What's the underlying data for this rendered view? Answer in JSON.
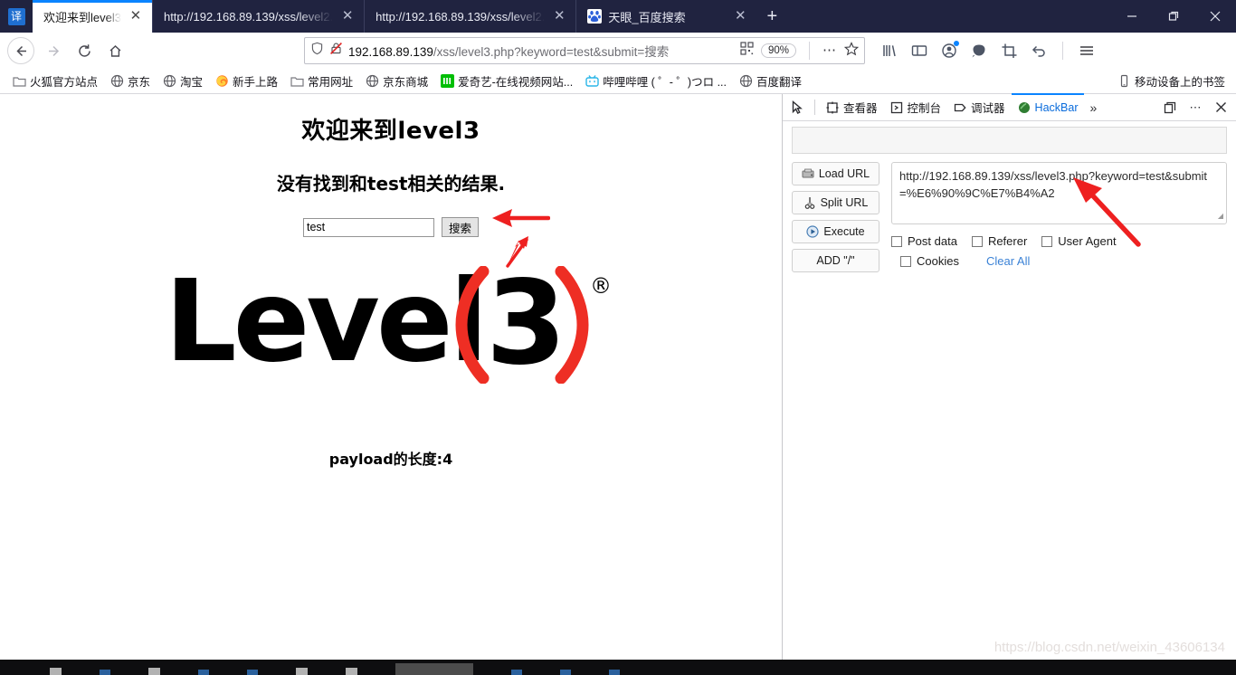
{
  "browser": {
    "tabs": [
      {
        "title": "欢迎来到level3",
        "favicon": "none",
        "active": true
      },
      {
        "title": "http://192.168.89.139/xss/level2.",
        "favicon": "none",
        "active": false
      },
      {
        "title": "http://192.168.89.139/xss/level2.",
        "favicon": "none",
        "active": false
      },
      {
        "title": "天眼_百度搜索",
        "favicon": "baidu-icon",
        "active": false
      }
    ],
    "translate_badge": "译",
    "new_tab_label": "+",
    "window_controls": {
      "minimize": "–",
      "maximize": "❐",
      "close": "✕"
    },
    "nav": {
      "back_icon": "back-arrow-icon",
      "forward_icon": "forward-arrow-icon",
      "reload_icon": "reload-icon",
      "home_icon": "home-icon",
      "url_host": "192.168.89.139",
      "url_path": "/xss/level3.php?keyword=test&submit=搜索",
      "shield_icon": "shield-icon",
      "insecure_icon": "insecure-lock-icon",
      "qr_icon": "qr-code-icon",
      "zoom_level": "90%",
      "more_icon": "ellipsis-icon",
      "bookmark_icon": "star-icon",
      "library_icon": "library-icon",
      "sidebar_icon": "sidebar-icon",
      "account_icon": "account-icon",
      "pocket_icon": "pocket-icon",
      "screenshot_icon": "screenshot-icon",
      "undo_icon": "undo-icon",
      "menu_icon": "hamburger-menu-icon"
    },
    "bookmarks": [
      {
        "label": "火狐官方站点",
        "icon": "folder-icon"
      },
      {
        "label": "京东",
        "icon": "globe-icon"
      },
      {
        "label": "淘宝",
        "icon": "globe-icon"
      },
      {
        "label": "新手上路",
        "icon": "firefox-icon"
      },
      {
        "label": "常用网址",
        "icon": "folder-icon"
      },
      {
        "label": "京东商城",
        "icon": "globe-icon"
      },
      {
        "label": "爱奇艺-在线视频网站...",
        "icon": "iqiyi-icon"
      },
      {
        "label": "哔哩哔哩 ( ゜- ゜)つロ ...",
        "icon": "bilibili-icon"
      },
      {
        "label": "百度翻译",
        "icon": "globe-icon"
      }
    ],
    "bookmarks_right": {
      "label": "移动设备上的书签",
      "icon": "mobile-icon"
    }
  },
  "page": {
    "welcome_heading": "欢迎来到level3",
    "result_text": "没有找到和test相关的结果.",
    "search_value": "test",
    "search_placeholder": "",
    "search_button": "搜索",
    "logo": {
      "text": "Level",
      "paren_open": "(",
      "digit": "3",
      "paren_close": ")",
      "registered": "®",
      "accent_color": "#ee2e24"
    },
    "payload_text": "payload的长度:4",
    "watermark": "https://blog.csdn.net/weixin_43606134"
  },
  "devtools": {
    "picker_icon": "element-picker-icon",
    "tabs": [
      {
        "label": "查看器",
        "icon": "inspector-icon",
        "active": false
      },
      {
        "label": "控制台",
        "icon": "console-icon",
        "active": false
      },
      {
        "label": "调试器",
        "icon": "debugger-icon",
        "active": false
      },
      {
        "label": "HackBar",
        "icon": "hackbar-icon",
        "active": true
      }
    ],
    "overflow_label": "»",
    "dock_icon": "dock-icon",
    "more_icon": "ellipsis-icon",
    "close_icon": "close-icon",
    "hackbar": {
      "buttons": [
        {
          "label": "Load URL",
          "icon": "load-url-icon"
        },
        {
          "label": "Split URL",
          "icon": "split-url-icon"
        },
        {
          "label": "Execute",
          "icon": "execute-icon"
        },
        {
          "label": "ADD \"/\"",
          "icon": "none"
        }
      ],
      "url_value": "http://192.168.89.139/xss/level3.php?keyword=test&submit=%E6%90%9C%E7%B4%A2",
      "checkboxes": [
        {
          "label": "Post data",
          "checked": false
        },
        {
          "label": "Referer",
          "checked": false
        },
        {
          "label": "User Agent",
          "checked": false
        },
        {
          "label": "Cookies",
          "checked": false
        }
      ],
      "clear_all_label": "Clear All",
      "clear_all_color": "#3b82d6"
    }
  },
  "annotations": {
    "arrow_color": "#ee2020",
    "arrow_result": "points-at-result-text",
    "arrow_search_button": "points-at-search-button",
    "arrow_hackbar_url": "points-at-hackbar-url-field"
  }
}
